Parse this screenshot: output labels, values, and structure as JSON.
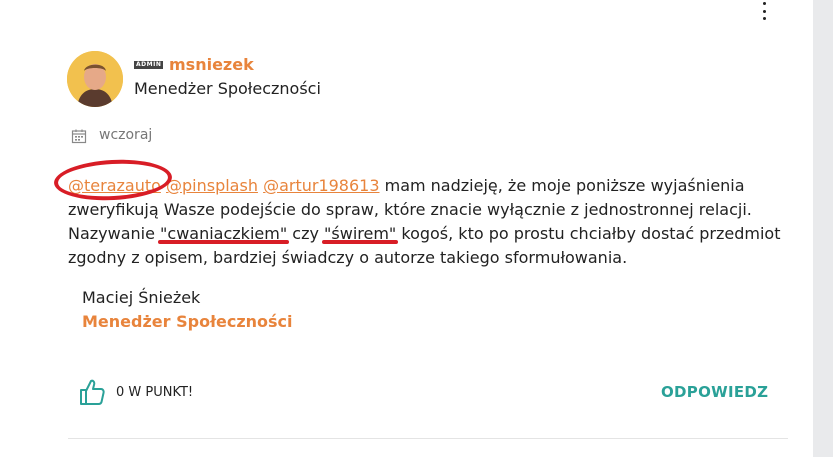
{
  "post": {
    "author": {
      "badge": "ADMIN",
      "username": "msniezek",
      "role": "Menedżer Społeczności"
    },
    "date": "wczoraj",
    "body": {
      "mention_1": "@terazauto",
      "mention_2": "@pinsplash",
      "mention_3": "@artur198613",
      "text_1": " mam nadzieję, że moje poniższe wyjaśnienia zweryfikują Wasze podejście do spraw, które znacie wyłącznie z jednostronnej relacji. Nazywanie ",
      "quote_1": "\"cwaniaczkiem\"",
      "text_2": " czy ",
      "quote_2": "\"świrem\"",
      "text_3": " kogoś, kto po prostu chciałby dostać przedmiot zgodny z opisem, bardziej świadczy o autorze takiego sformułowania."
    },
    "signature": {
      "name": "Maciej Śnieżek",
      "role": "Menedżer Społeczności"
    },
    "actions": {
      "like_label": "0 W PUNKT!",
      "reply_label": "ODPOWIEDZ"
    }
  },
  "colors": {
    "accent_orange": "#e8843c",
    "reply_teal": "#2aa198",
    "annotation_red": "#d81d26"
  },
  "icons": {
    "menu": "more-vertical-icon",
    "date": "calendar-icon",
    "like": "thumbs-up-icon"
  }
}
